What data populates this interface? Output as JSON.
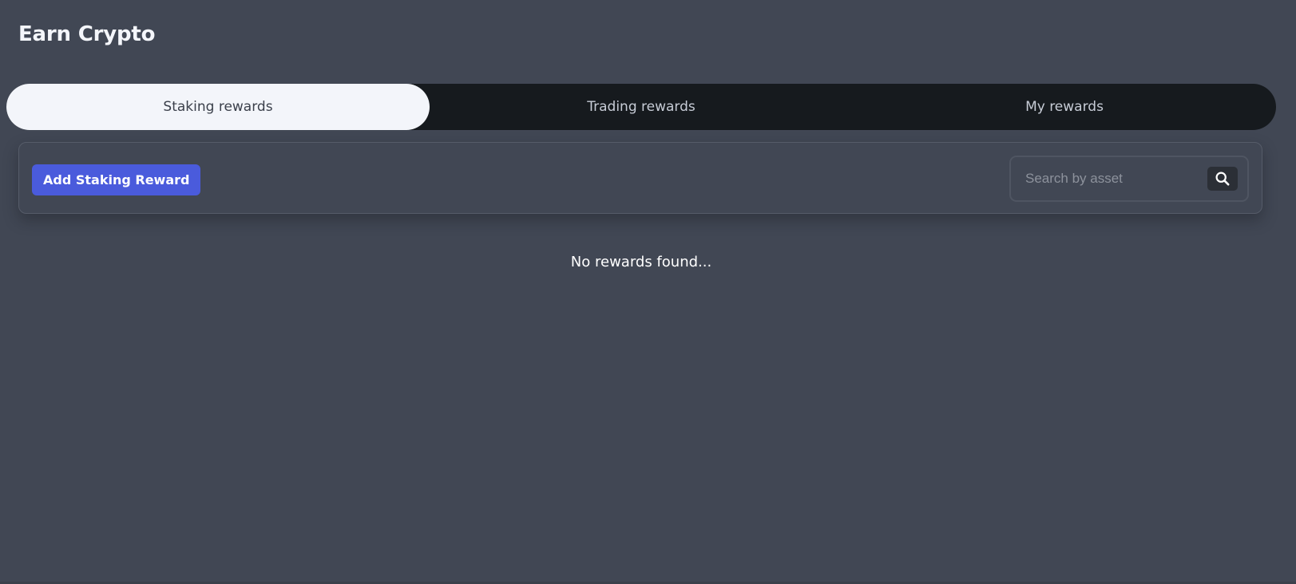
{
  "page": {
    "title": "Earn Crypto"
  },
  "tabs": [
    {
      "label": "Staking rewards",
      "active": true
    },
    {
      "label": "Trading rewards",
      "active": false
    },
    {
      "label": "My rewards",
      "active": false
    }
  ],
  "toolbar": {
    "add_button_label": "Add Staking Reward",
    "search": {
      "placeholder": "Search by asset",
      "value": "",
      "icon": "search-icon"
    }
  },
  "rewards": {
    "empty_message": "No rewards found..."
  },
  "colors": {
    "background": "#414754",
    "tab_bar": "#161a1e",
    "active_tab": "#f3f5fa",
    "primary_button": "#4a5bdc"
  }
}
